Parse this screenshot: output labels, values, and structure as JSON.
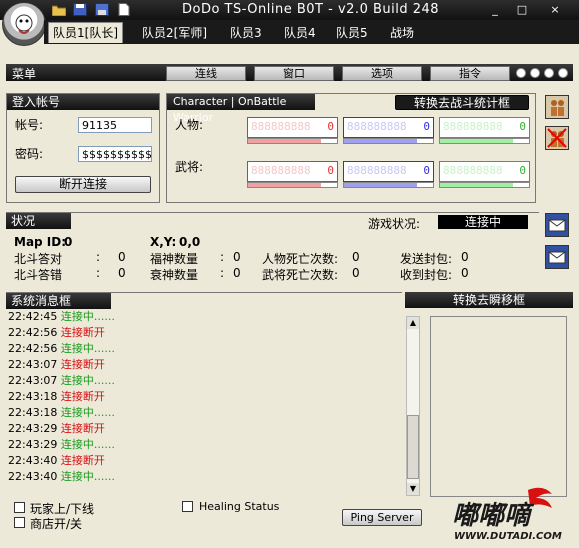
{
  "window": {
    "title": "DoDo TS-Online B0T - ",
    "version": "v2.0 Build 248",
    "buttons": [
      "_",
      "□",
      "×"
    ]
  },
  "toolbar_icons": [
    "folder-icon",
    "save-icon",
    "save-as-icon",
    "document-icon"
  ],
  "tabs": [
    {
      "label": "队员1[队长]",
      "active": true
    },
    {
      "label": "队员2[军师]"
    },
    {
      "label": "队员3"
    },
    {
      "label": "队员4"
    },
    {
      "label": "队员5"
    },
    {
      "label": "战场"
    }
  ],
  "menu": {
    "title": "菜单",
    "items": [
      "连线",
      "窗口",
      "选项",
      "指令"
    ]
  },
  "login": {
    "header": "登入帐号",
    "account_label": "帐号:",
    "account_value": "91135",
    "password_label": "密码:",
    "password_value": "$$$$$$$$$$",
    "disconnect_button": "断开连接"
  },
  "battle": {
    "header": "Character | OnBattle Warrior",
    "switch_button": "转换去战斗统计框",
    "character_label": "人物:",
    "warrior_label": "武将:",
    "ghost": "888888888",
    "values": [
      "0",
      "0",
      "0",
      "0",
      "0",
      "0"
    ],
    "colors": {
      "red": "#e03030",
      "blue": "#3030e0",
      "green": "#30b030"
    }
  },
  "status": {
    "header": "状况",
    "game_status_label": "游戏状况:",
    "game_status_value": "连接中",
    "map_id_label": "Map ID:",
    "map_id_value": "0",
    "xy_label": "X,Y:",
    "xy_value": "0,0",
    "rows": [
      [
        {
          "label": "北斗答对",
          "value": "0"
        },
        {
          "label": "福神数量",
          "value": "0"
        },
        {
          "label": "人物死亡次数:",
          "value": "0"
        },
        {
          "label": "发送封包:",
          "value": "0"
        }
      ],
      [
        {
          "label": "北斗答错",
          "value": "0"
        },
        {
          "label": "衰神数量",
          "value": "0"
        },
        {
          "label": "武将死亡次数:",
          "value": "0"
        },
        {
          "label": "收到封包:",
          "value": "0"
        }
      ]
    ]
  },
  "log": {
    "header": "系统消息框",
    "lines": [
      {
        "time": "22:42:45",
        "msg": "连接中......",
        "color": "g"
      },
      {
        "time": "22:42:56",
        "msg": "连接断开",
        "color": "r"
      },
      {
        "time": "22:42:56",
        "msg": "连接中......",
        "color": "g"
      },
      {
        "time": "22:43:07",
        "msg": "连接断开",
        "color": "r"
      },
      {
        "time": "22:43:07",
        "msg": "连接中......",
        "color": "g"
      },
      {
        "time": "22:43:18",
        "msg": "连接断开",
        "color": "r"
      },
      {
        "time": "22:43:18",
        "msg": "连接中......",
        "color": "g"
      },
      {
        "time": "22:43:29",
        "msg": "连接断开",
        "color": "r"
      },
      {
        "time": "22:43:29",
        "msg": "连接中......",
        "color": "g"
      },
      {
        "time": "22:43:40",
        "msg": "连接断开",
        "color": "r"
      },
      {
        "time": "22:43:40",
        "msg": "连接中......",
        "color": "g"
      }
    ]
  },
  "checkboxes": {
    "player_online": "玩家上/下线",
    "shop_toggle": "商店开/关",
    "healing_status": "Healing Status"
  },
  "ping_button": "Ping Server",
  "teleport": {
    "header": "转换去瞬移框"
  },
  "watermark": "嘟嘟嘀 WWW.DUTADI.COM"
}
